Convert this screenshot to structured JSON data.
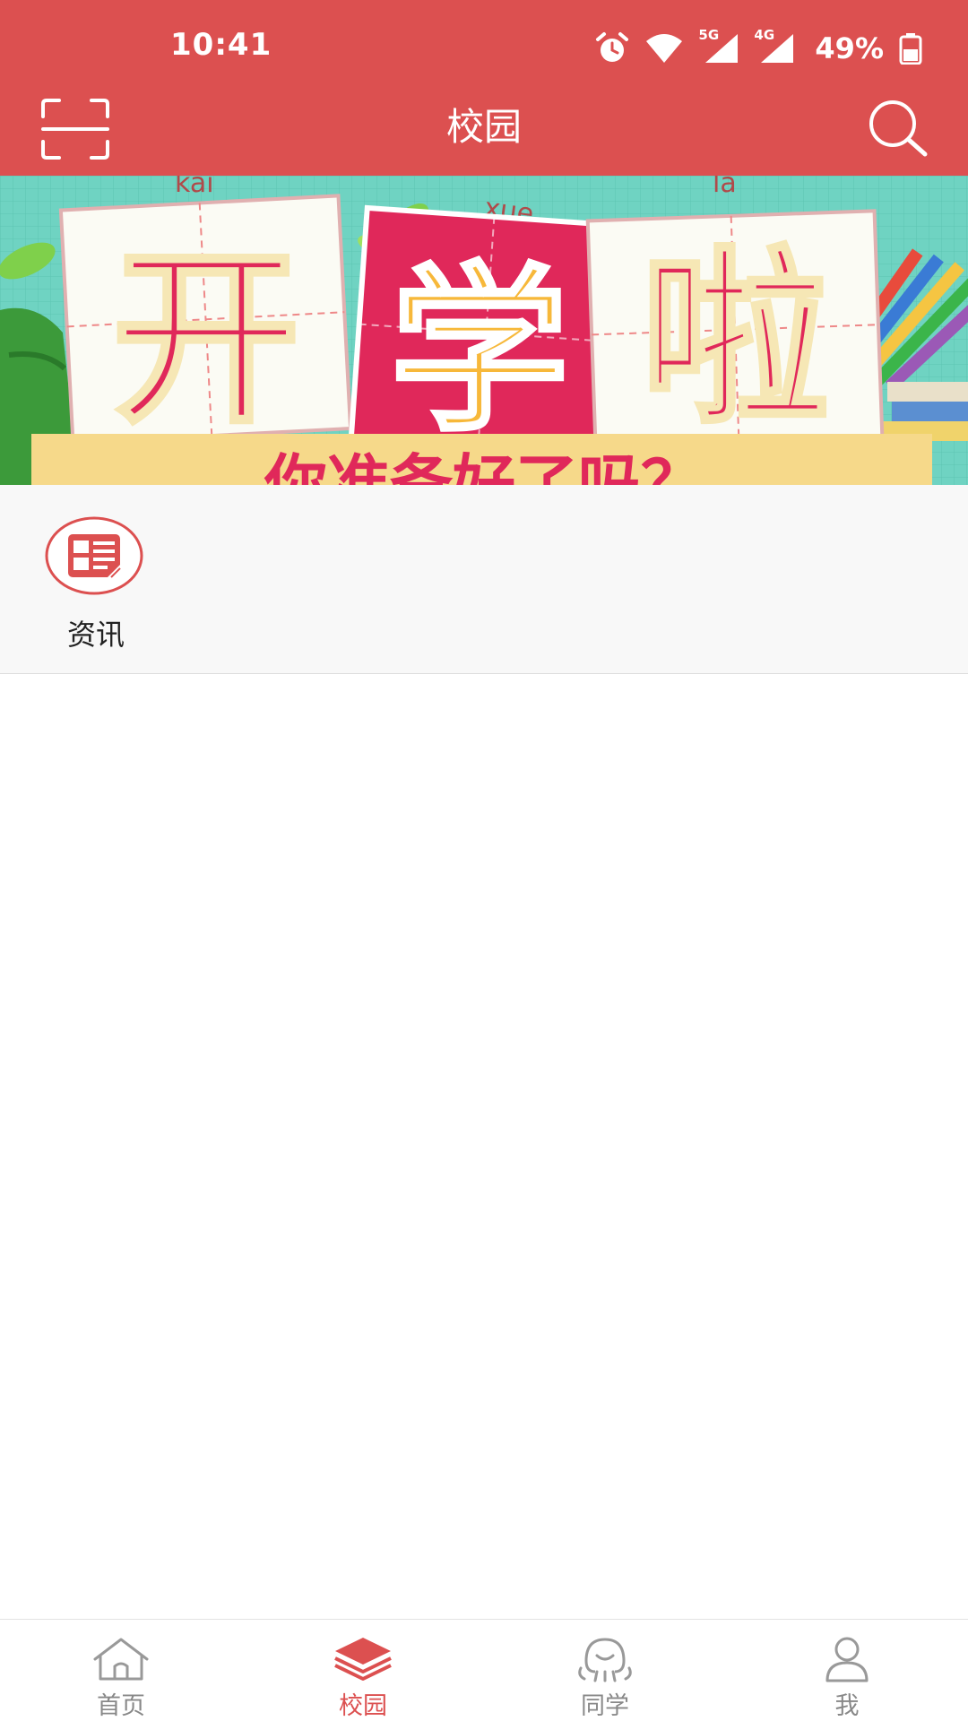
{
  "status_bar": {
    "time": "10:41",
    "network_5g": "5G",
    "network_4g": "4G",
    "battery": "49%"
  },
  "app_bar": {
    "title": "校园",
    "left_icon": "scan-icon",
    "right_icon": "search-icon"
  },
  "banner": {
    "pinyin": [
      "kai",
      "xue",
      "la"
    ],
    "headline": [
      "开",
      "学",
      "啦"
    ],
    "subtitle": "你准备好了吗？"
  },
  "quick_links": [
    {
      "label": "资讯",
      "icon": "news-icon"
    }
  ],
  "bottom_nav": {
    "active_index": 1,
    "items": [
      {
        "label": "首页",
        "icon": "home-icon"
      },
      {
        "label": "校园",
        "icon": "campus-icon"
      },
      {
        "label": "同学",
        "icon": "classmates-icon"
      },
      {
        "label": "我",
        "icon": "profile-icon"
      }
    ]
  },
  "colors": {
    "brand": "#dc5050",
    "nav_inactive": "#888888",
    "banner_teal": "#6fd3c2",
    "banner_red": "#e0285a",
    "banner_yellow": "#f7b83a"
  }
}
